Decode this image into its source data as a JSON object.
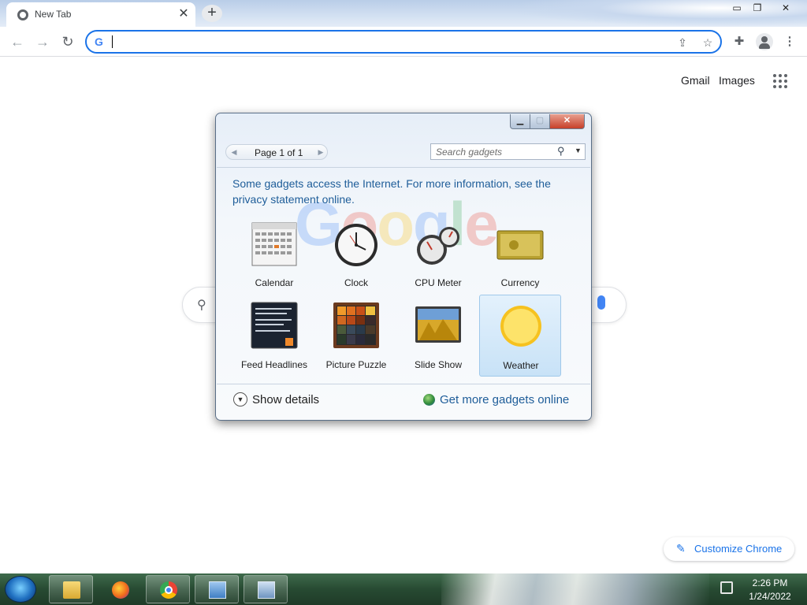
{
  "browser": {
    "tab_title": "New Tab",
    "tab_close": "✕",
    "new_tab": "+",
    "window_minimize": "▭",
    "window_restore": "❐",
    "window_close": "✕",
    "omnibox_value": ""
  },
  "page": {
    "gmail": "Gmail",
    "images": "Images",
    "customize_label": "Customize Chrome"
  },
  "gadget_dialog": {
    "pager_label": "Page 1 of 1",
    "search_placeholder": "Search gadgets",
    "notice": "Some gadgets access the Internet.  For more information, see the privacy statement online.",
    "gadgets": [
      {
        "label": "Calendar",
        "icon": "calendar-icon"
      },
      {
        "label": "Clock",
        "icon": "clock-icon"
      },
      {
        "label": "CPU Meter",
        "icon": "cpu-meter-icon"
      },
      {
        "label": "Currency",
        "icon": "currency-icon"
      },
      {
        "label": "Feed Headlines",
        "icon": "feed-headlines-icon"
      },
      {
        "label": "Picture Puzzle",
        "icon": "picture-puzzle-icon"
      },
      {
        "label": "Slide Show",
        "icon": "slide-show-icon"
      },
      {
        "label": "Weather",
        "icon": "weather-icon",
        "selected": true
      }
    ],
    "show_details": "Show details",
    "more_gadgets": "Get more gadgets online"
  },
  "taskbar": {
    "apps": [
      "file-explorer-icon",
      "firefox-icon",
      "chrome-icon",
      "control-panel-icon",
      "gadgets-icon"
    ],
    "clock_time": "2:26 PM",
    "clock_date": "1/24/2022"
  },
  "colors": {
    "accent_blue": "#1a73e8",
    "link_blue": "#1e5d99",
    "taskbar_green": "#274a32"
  }
}
